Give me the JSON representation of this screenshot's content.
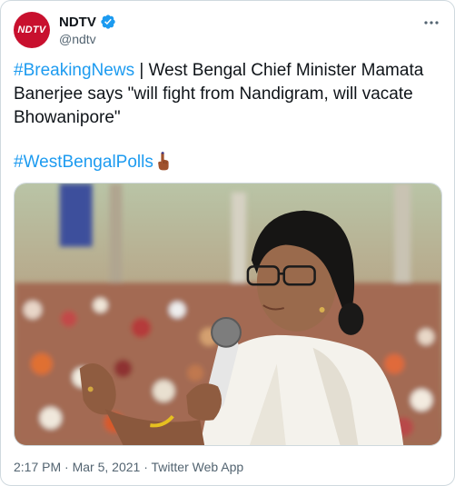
{
  "account": {
    "display_name": "NDTV",
    "handle": "@ndtv",
    "avatar_text": "NDTV",
    "verified": true,
    "brand_color": "#c8102e"
  },
  "tweet": {
    "hashtag_breaking": "#BreakingNews",
    "separator": " | ",
    "body": "West Bengal Chief Minister Mamata Banerjee says \"will fight from Nandigram, will vacate Bhowanipore\"",
    "hashtag_polls": "#WestBengalPolls",
    "emoji": "inked-finger-icon"
  },
  "meta": {
    "time": "2:17 PM",
    "dot1": " · ",
    "date": "Mar 5, 2021",
    "dot2": " · ",
    "source": "Twitter Web App"
  },
  "colors": {
    "link": "#1d9bf0",
    "secondary_text": "#536471",
    "border": "#cfd9de"
  }
}
